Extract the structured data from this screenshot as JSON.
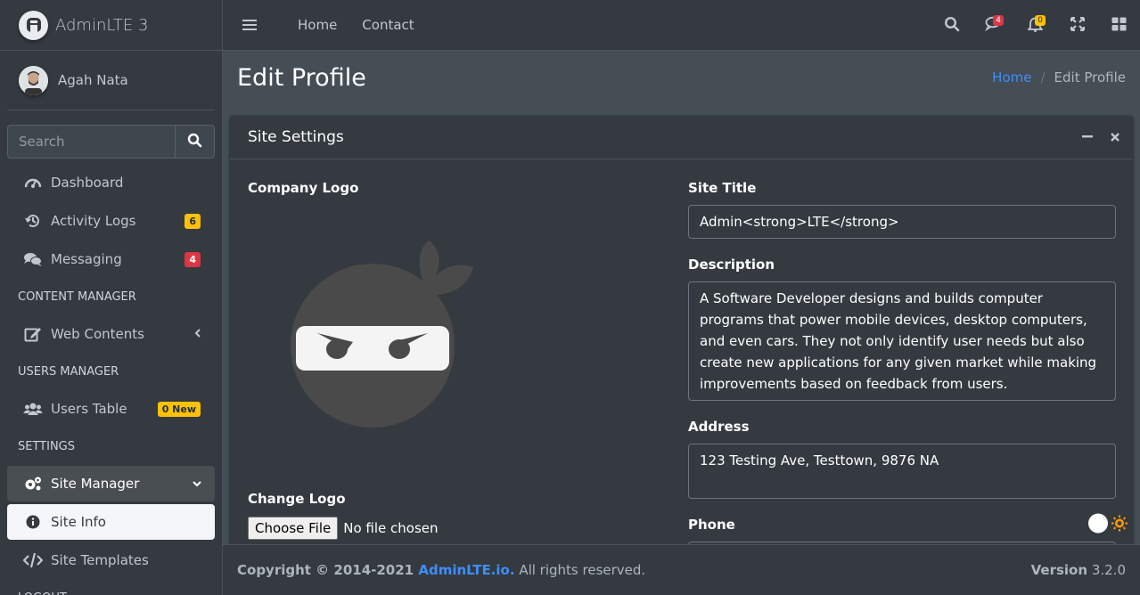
{
  "brand": {
    "name": "AdminLTE 3"
  },
  "user": {
    "name": "Agah Nata"
  },
  "search": {
    "placeholder": "Search"
  },
  "sidebar": {
    "items": [
      {
        "label": "Dashboard",
        "icon": "dashboard-icon"
      },
      {
        "label": "Activity Logs",
        "icon": "history-icon",
        "badge": "6"
      },
      {
        "label": "Messaging",
        "icon": "comments-icon",
        "badge": "4"
      }
    ],
    "header_content": "CONTENT MANAGER",
    "web_contents": "Web Contents",
    "header_users": "USERS MANAGER",
    "users_table": "Users Table",
    "users_badge": "0 New",
    "header_settings": "SETTINGS",
    "site_manager": "Site Manager",
    "site_info": "Site Info",
    "site_templates": "Site Templates",
    "header_logout": "LOGOUT"
  },
  "topbar": {
    "home": "Home",
    "contact": "Contact",
    "messages_count": "4",
    "notifications_count": "0"
  },
  "page": {
    "title": "Edit Profile",
    "breadcrumb_home": "Home",
    "breadcrumb_sep": "/",
    "breadcrumb_current": "Edit Profile"
  },
  "card": {
    "title": "Site Settings",
    "company_logo_label": "Company Logo",
    "change_logo_label": "Change Logo",
    "choose_file": "Choose File",
    "no_file": "No file chosen",
    "site_title_label": "Site Title",
    "site_title_value": "Admin<strong>LTE</strong>",
    "description_label": "Description",
    "description_value": "A Software Developer designs and builds computer programs that power mobile devices, desktop computers, and even cars. They not only identify user needs but also create new applications for any given market while making improvements based on feedback from users.",
    "address_label": "Address",
    "address_value": "123 Testing Ave, Testtown, 9876 NA",
    "phone_label": "Phone"
  },
  "footer": {
    "copyright_prefix": "Copyright © 2014-2021 ",
    "copyright_link": "AdminLTE.io.",
    "copyright_suffix": " All rights reserved.",
    "version_label": "Version",
    "version_value": "3.2.0"
  },
  "colors": {
    "sidebar_bg": "#343a40",
    "content_bg": "#454d55",
    "accent_link": "#3f8ef8",
    "badge_warning": "#ffc107",
    "badge_danger": "#dc3545"
  }
}
